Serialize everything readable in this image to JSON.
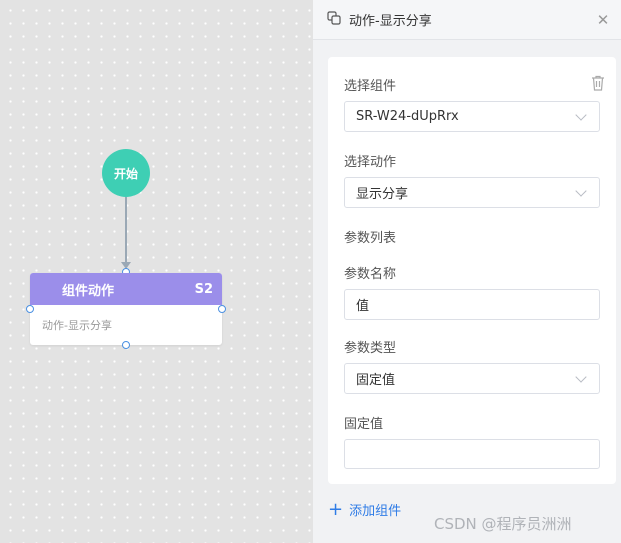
{
  "canvas": {
    "start_node_label": "开始",
    "action_node": {
      "title": "组件动作",
      "badge": "S2",
      "subtitle": "动作-显示分享"
    }
  },
  "panel": {
    "title": "动作-显示分享",
    "header_icon": "component-icon",
    "close_icon": "close-icon",
    "form": {
      "select_component_label": "选择组件",
      "select_component_value": "SR-W24-dUpRrx",
      "select_action_label": "选择动作",
      "select_action_value": "显示分享",
      "param_list_label": "参数列表",
      "param_name_label": "参数名称",
      "param_name_value": "值",
      "param_type_label": "参数类型",
      "param_type_value": "固定值",
      "fixed_value_label": "固定值",
      "fixed_value_value": ""
    },
    "add_component_label": "添加组件"
  },
  "watermark": "CSDN @程序员洲洲",
  "colors": {
    "start_node": "#3ecfb4",
    "action_header": "#9b8eea",
    "link": "#2f7ce6",
    "port": "#4a90e2"
  }
}
